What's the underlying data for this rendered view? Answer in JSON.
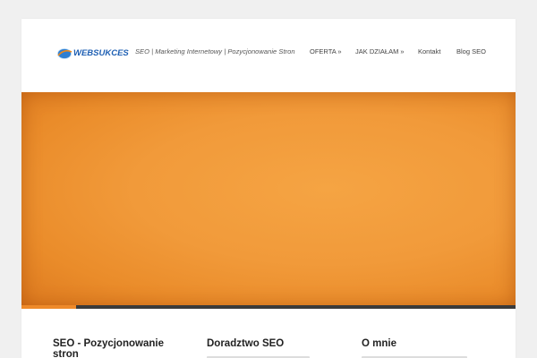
{
  "header": {
    "logo_text": "WEBSUKCES",
    "tagline": "SEO | Marketing Internetowy | Pozycjonowanie Stron"
  },
  "nav": {
    "items": [
      {
        "label": "OFERTA »"
      },
      {
        "label": "JAK DZIAŁAM »"
      },
      {
        "label": "Kontakt"
      },
      {
        "label": "Blog SEO"
      }
    ]
  },
  "slider": {
    "progress": 0.11,
    "colors": {
      "accent": "#ee8a2a",
      "track": "#3a3a3a",
      "hero": "#f19a3a"
    }
  },
  "widgets": [
    {
      "title": "SEO - Pozycjonowanie stron"
    },
    {
      "title": "Doradztwo SEO"
    },
    {
      "title": "O mnie"
    }
  ]
}
